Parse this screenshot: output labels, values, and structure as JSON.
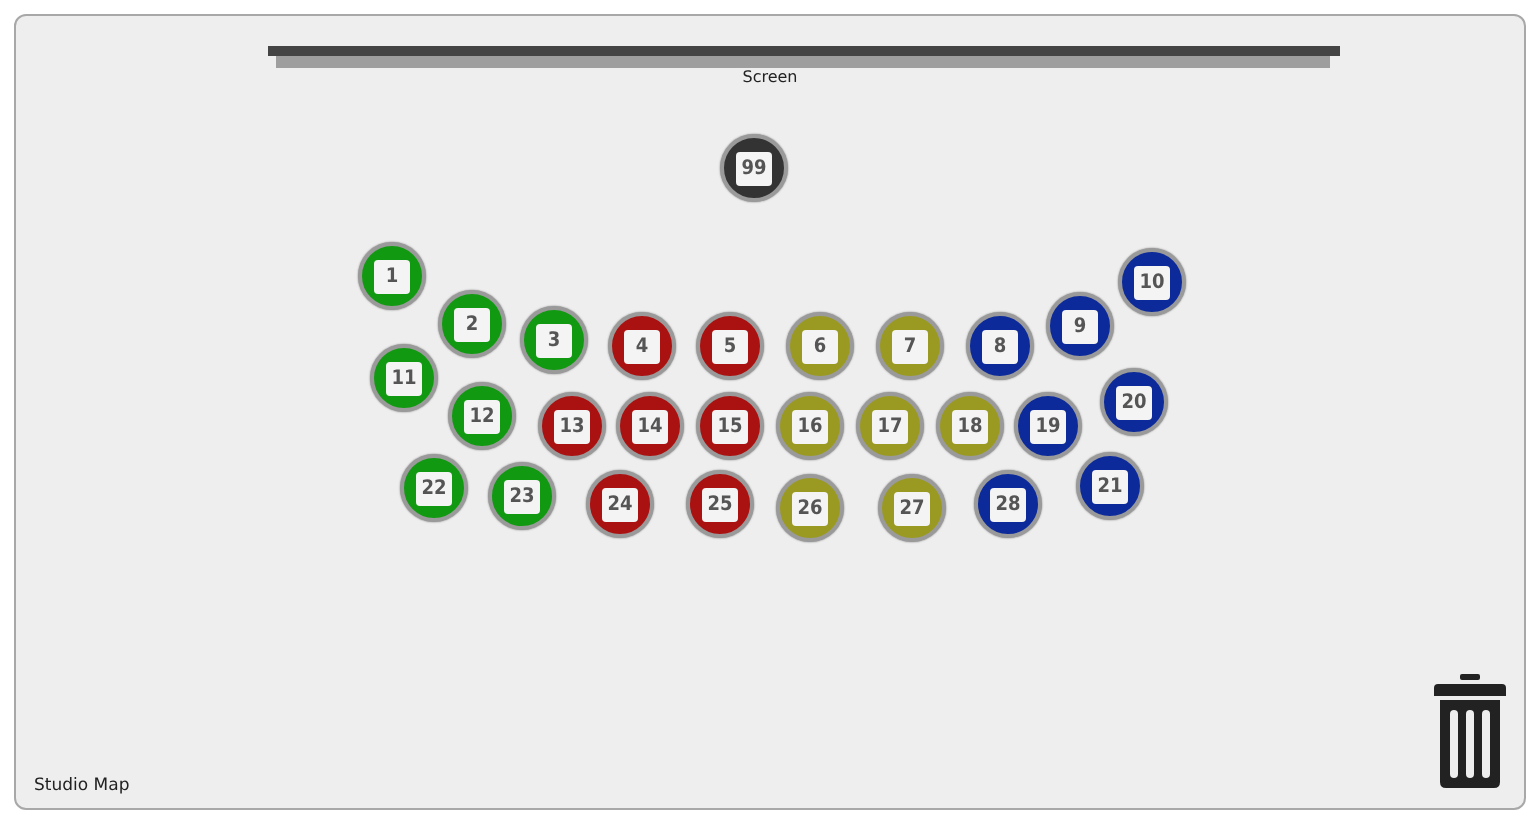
{
  "screen": {
    "label": "Screen"
  },
  "seats": [
    {
      "label": "99",
      "color": "#333333"
    },
    {
      "label": "1",
      "color": "#119911"
    },
    {
      "label": "2",
      "color": "#119911"
    },
    {
      "label": "3",
      "color": "#119911"
    },
    {
      "label": "4",
      "color": "#aa1111"
    },
    {
      "label": "5",
      "color": "#aa1111"
    },
    {
      "label": "6",
      "color": "#9a9a22"
    },
    {
      "label": "7",
      "color": "#9a9a22"
    },
    {
      "label": "8",
      "color": "#0c2a9a"
    },
    {
      "label": "9",
      "color": "#0c2a9a"
    },
    {
      "label": "10",
      "color": "#0c2a9a"
    },
    {
      "label": "11",
      "color": "#119911"
    },
    {
      "label": "12",
      "color": "#119911"
    },
    {
      "label": "13",
      "color": "#aa1111"
    },
    {
      "label": "14",
      "color": "#aa1111"
    },
    {
      "label": "15",
      "color": "#aa1111"
    },
    {
      "label": "16",
      "color": "#9a9a22"
    },
    {
      "label": "17",
      "color": "#9a9a22"
    },
    {
      "label": "18",
      "color": "#9a9a22"
    },
    {
      "label": "19",
      "color": "#0c2a9a"
    },
    {
      "label": "20",
      "color": "#0c2a9a"
    },
    {
      "label": "21",
      "color": "#0c2a9a"
    },
    {
      "label": "22",
      "color": "#119911"
    },
    {
      "label": "23",
      "color": "#119911"
    },
    {
      "label": "24",
      "color": "#aa1111"
    },
    {
      "label": "25",
      "color": "#aa1111"
    },
    {
      "label": "26",
      "color": "#9a9a22"
    },
    {
      "label": "27",
      "color": "#9a9a22"
    },
    {
      "label": "28",
      "color": "#0c2a9a"
    }
  ],
  "footer": {
    "label": "Studio Map"
  }
}
